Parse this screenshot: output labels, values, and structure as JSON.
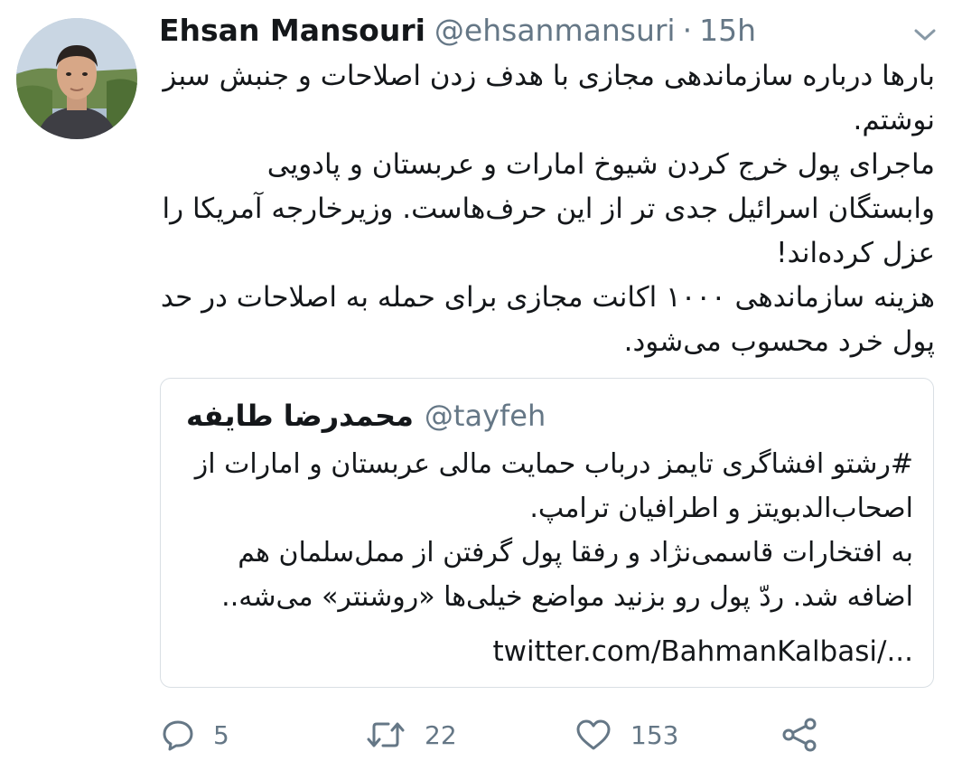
{
  "tweet": {
    "author_name": "Ehsan Mansouri",
    "author_handle": "@ehsanmansuri",
    "separator": "·",
    "time": "15h",
    "body_lines": [
      "بارها درباره سازماندهی مجازی با هدف زدن اصلاحات و جنبش سبز نوشتم.",
      "ماجرای پول خرج کردن شیوخ امارات و عربستان و پادویی وابستگان اسرائیل جدی تر از این حرف‌هاست. وزیرخارجه آمریکا را عزل کرده‌اند!",
      "هزینه سازماندهی ۱۰۰۰ اکانت مجازی برای حمله به اصلاحات در حد پول خرد محسوب می‌شود."
    ]
  },
  "quoted": {
    "author_name": "محمدرضا طایفه",
    "author_handle": "@tayfeh",
    "body_lines": [
      "#رشتو افشاگری تایمز درباب حمایت مالی عربستان و امارات از اصحاب‌الدبویتز و اطرافیان ترامپ.",
      "به افتخارات قاسمی‌نژاد و رفقا پول گرفتن از ممل‌سلمان هم اضافه شد. ردّ پول رو بزنید مواضع خیلی‌ها «روشنتر» می‌شه.."
    ],
    "link": "twitter.com/BahmanKalbasi/..."
  },
  "actions": {
    "replies": "5",
    "retweets": "22",
    "likes": "153"
  },
  "icons": {
    "reply": "reply-icon",
    "retweet": "retweet-icon",
    "like": "heart-icon",
    "share": "share-icon",
    "menu": "chevron-down-icon"
  },
  "colors": {
    "text": "#14171a",
    "secondary": "#657786",
    "border": "#d9dfe4"
  }
}
